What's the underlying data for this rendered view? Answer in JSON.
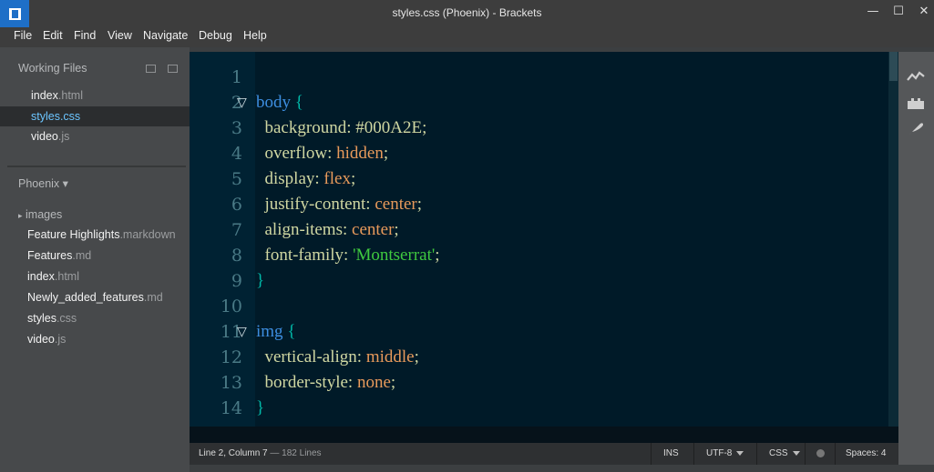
{
  "window": {
    "title": "styles.css (Phoenix) - Brackets"
  },
  "menu": [
    "File",
    "Edit",
    "Find",
    "View",
    "Navigate",
    "Debug",
    "Help"
  ],
  "working_files": {
    "title": "Working Files",
    "files": [
      {
        "name": "index",
        "ext": ".html",
        "selected": false
      },
      {
        "name": "styles",
        "ext": ".css",
        "selected": true
      },
      {
        "name": "video",
        "ext": ".js",
        "selected": false
      }
    ]
  },
  "project": {
    "title": "Phoenix",
    "folder": "images",
    "files": [
      {
        "name": "Feature Highlights",
        "ext": ".markdown"
      },
      {
        "name": "Features",
        "ext": ".md"
      },
      {
        "name": "index",
        "ext": ".html"
      },
      {
        "name": "Newly_added_features",
        "ext": ".md"
      },
      {
        "name": "styles",
        "ext": ".css"
      },
      {
        "name": "video",
        "ext": ".js"
      }
    ]
  },
  "editor": {
    "line_numbers": [
      "1",
      "2",
      "3",
      "4",
      "5",
      "6",
      "7",
      "8",
      "9",
      "10",
      "11",
      "12",
      "13",
      "14"
    ],
    "fold_markers": [
      "2",
      "11"
    ],
    "lines": [
      [],
      [
        {
          "t": "sel",
          "v": "body "
        },
        {
          "t": "brace",
          "v": "{"
        }
      ],
      [
        {
          "t": "prop",
          "v": "  background: "
        },
        {
          "t": "prop",
          "v": "#000A2E"
        },
        {
          "t": "punc",
          "v": ";"
        }
      ],
      [
        {
          "t": "prop",
          "v": "  overflow: "
        },
        {
          "t": "val",
          "v": "hidden"
        },
        {
          "t": "punc",
          "v": ";"
        }
      ],
      [
        {
          "t": "prop",
          "v": "  display: "
        },
        {
          "t": "val",
          "v": "flex"
        },
        {
          "t": "punc",
          "v": ";"
        }
      ],
      [
        {
          "t": "prop",
          "v": "  justify-content: "
        },
        {
          "t": "val",
          "v": "center"
        },
        {
          "t": "punc",
          "v": ";"
        }
      ],
      [
        {
          "t": "prop",
          "v": "  align-items: "
        },
        {
          "t": "val",
          "v": "center"
        },
        {
          "t": "punc",
          "v": ";"
        }
      ],
      [
        {
          "t": "prop",
          "v": "  font-family: "
        },
        {
          "t": "str",
          "v": "'Montserrat'"
        },
        {
          "t": "punc",
          "v": ";"
        }
      ],
      [
        {
          "t": "brace",
          "v": "}"
        }
      ],
      [],
      [
        {
          "t": "sel",
          "v": "img "
        },
        {
          "t": "brace",
          "v": "{"
        }
      ],
      [
        {
          "t": "prop",
          "v": "  vertical-align: "
        },
        {
          "t": "val",
          "v": "middle"
        },
        {
          "t": "punc",
          "v": ";"
        }
      ],
      [
        {
          "t": "prop",
          "v": "  border-style: "
        },
        {
          "t": "val",
          "v": "none"
        },
        {
          "t": "punc",
          "v": ";"
        }
      ],
      [
        {
          "t": "brace",
          "v": "}"
        }
      ]
    ]
  },
  "status": {
    "cursor": "Line 2, Column 7",
    "lines": "— 182 Lines",
    "mode": "INS",
    "encoding": "UTF-8",
    "language": "CSS",
    "indent": "Spaces: 4"
  },
  "colors": {
    "accent": "#6cc5ff",
    "editor_bg": "#001a28",
    "gutter_bg": "#002233",
    "app_icon": "#1e6fc7"
  },
  "icons": {
    "live_preview": "live-preview-icon",
    "extensions": "extension-manager-icon",
    "feather": "feather-icon"
  }
}
